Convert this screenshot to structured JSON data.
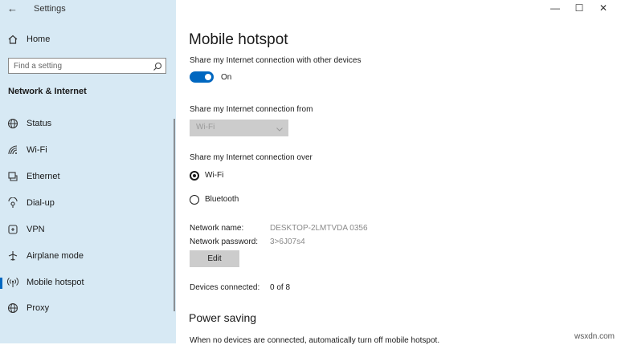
{
  "window": {
    "app_title": "Settings",
    "back_glyph": "←",
    "controls": {
      "minimize": "—",
      "maximize": "☐",
      "close": "✕"
    }
  },
  "sidebar": {
    "home_label": "Home",
    "search_placeholder": "Find a setting",
    "section_heading": "Network & Internet",
    "items": [
      {
        "label": "Status",
        "icon": "globe-icon"
      },
      {
        "label": "Wi-Fi",
        "icon": "wifi-icon"
      },
      {
        "label": "Ethernet",
        "icon": "ethernet-icon"
      },
      {
        "label": "Dial-up",
        "icon": "dialup-icon"
      },
      {
        "label": "VPN",
        "icon": "vpn-icon"
      },
      {
        "label": "Airplane mode",
        "icon": "airplane-icon"
      },
      {
        "label": "Mobile hotspot",
        "icon": "hotspot-icon"
      },
      {
        "label": "Proxy",
        "icon": "globe-icon"
      }
    ],
    "active_item": "Mobile hotspot"
  },
  "main": {
    "title": "Mobile hotspot",
    "share_label": "Share my Internet connection with other devices",
    "toggle_state": "On",
    "share_from_label": "Share my Internet connection from",
    "share_from_value": "Wi-Fi",
    "share_over_label": "Share my Internet connection over",
    "over_options": [
      {
        "label": "Wi-Fi",
        "selected": true
      },
      {
        "label": "Bluetooth",
        "selected": false
      }
    ],
    "network_name_label": "Network name:",
    "network_name_value": "DESKTOP-2LMTVDA 0356",
    "network_password_label": "Network password:",
    "network_password_value": "3>6J07s4",
    "edit_label": "Edit",
    "devices_connected_label": "Devices connected:",
    "devices_connected_value": "0 of 8",
    "power_saving_heading": "Power saving",
    "power_saving_text": "When no devices are connected, automatically turn off mobile hotspot."
  },
  "watermark": "wsxdn.com",
  "colors": {
    "sidebar_bg": "#d7e9f4",
    "accent": "#0067c0",
    "disabled_control": "#cccccc"
  }
}
